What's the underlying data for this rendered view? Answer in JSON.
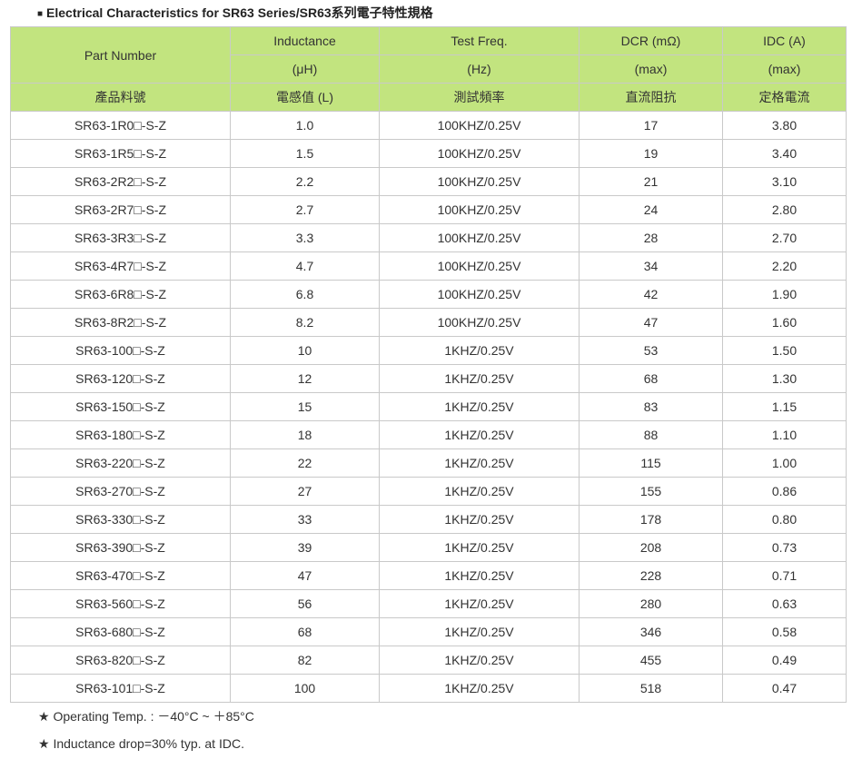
{
  "title": {
    "bullet": "■",
    "text": "Electrical Characteristics for SR63 Series/SR63系列電子特性規格"
  },
  "header": {
    "part_number": "Part Number",
    "inductance": "Inductance",
    "inductance_unit": "(μH)",
    "test_freq": "Test Freq.",
    "test_freq_unit": "(Hz)",
    "dcr": "DCR (mΩ)",
    "dcr_unit": "(max)",
    "idc": "IDC (A)",
    "idc_unit": "(max)",
    "part_number_cn": "產品料號",
    "inductance_cn": "電感值 (L)",
    "test_freq_cn": "測試頻率",
    "dcr_cn": "直流阻抗",
    "idc_cn": "定格電流"
  },
  "rows": [
    {
      "part": "SR63-1R0□-S-Z",
      "inductance": "1.0",
      "freq": "100KHZ/0.25V",
      "dcr": "17",
      "idc": "3.80"
    },
    {
      "part": "SR63-1R5□-S-Z",
      "inductance": "1.5",
      "freq": "100KHZ/0.25V",
      "dcr": "19",
      "idc": "3.40"
    },
    {
      "part": "SR63-2R2□-S-Z",
      "inductance": "2.2",
      "freq": "100KHZ/0.25V",
      "dcr": "21",
      "idc": "3.10"
    },
    {
      "part": "SR63-2R7□-S-Z",
      "inductance": "2.7",
      "freq": "100KHZ/0.25V",
      "dcr": "24",
      "idc": "2.80"
    },
    {
      "part": "SR63-3R3□-S-Z",
      "inductance": "3.3",
      "freq": "100KHZ/0.25V",
      "dcr": "28",
      "idc": "2.70"
    },
    {
      "part": "SR63-4R7□-S-Z",
      "inductance": "4.7",
      "freq": "100KHZ/0.25V",
      "dcr": "34",
      "idc": "2.20"
    },
    {
      "part": "SR63-6R8□-S-Z",
      "inductance": "6.8",
      "freq": "100KHZ/0.25V",
      "dcr": "42",
      "idc": "1.90"
    },
    {
      "part": "SR63-8R2□-S-Z",
      "inductance": "8.2",
      "freq": "100KHZ/0.25V",
      "dcr": "47",
      "idc": "1.60"
    },
    {
      "part": "SR63-100□-S-Z",
      "inductance": "10",
      "freq": "1KHZ/0.25V",
      "dcr": "53",
      "idc": "1.50"
    },
    {
      "part": "SR63-120□-S-Z",
      "inductance": "12",
      "freq": "1KHZ/0.25V",
      "dcr": "68",
      "idc": "1.30"
    },
    {
      "part": "SR63-150□-S-Z",
      "inductance": "15",
      "freq": "1KHZ/0.25V",
      "dcr": "83",
      "idc": "1.15"
    },
    {
      "part": "SR63-180□-S-Z",
      "inductance": "18",
      "freq": "1KHZ/0.25V",
      "dcr": "88",
      "idc": "1.10"
    },
    {
      "part": "SR63-220□-S-Z",
      "inductance": "22",
      "freq": "1KHZ/0.25V",
      "dcr": "115",
      "idc": "1.00"
    },
    {
      "part": "SR63-270□-S-Z",
      "inductance": "27",
      "freq": "1KHZ/0.25V",
      "dcr": "155",
      "idc": "0.86"
    },
    {
      "part": "SR63-330□-S-Z",
      "inductance": "33",
      "freq": "1KHZ/0.25V",
      "dcr": "178",
      "idc": "0.80"
    },
    {
      "part": "SR63-390□-S-Z",
      "inductance": "39",
      "freq": "1KHZ/0.25V",
      "dcr": "208",
      "idc": "0.73"
    },
    {
      "part": "SR63-470□-S-Z",
      "inductance": "47",
      "freq": "1KHZ/0.25V",
      "dcr": "228",
      "idc": "0.71"
    },
    {
      "part": "SR63-560□-S-Z",
      "inductance": "56",
      "freq": "1KHZ/0.25V",
      "dcr": "280",
      "idc": "0.63"
    },
    {
      "part": "SR63-680□-S-Z",
      "inductance": "68",
      "freq": "1KHZ/0.25V",
      "dcr": "346",
      "idc": "0.58"
    },
    {
      "part": "SR63-820□-S-Z",
      "inductance": "82",
      "freq": "1KHZ/0.25V",
      "dcr": "455",
      "idc": "0.49"
    },
    {
      "part": "SR63-101□-S-Z",
      "inductance": "100",
      "freq": "1KHZ/0.25V",
      "dcr": "518",
      "idc": "0.47"
    }
  ],
  "notes": [
    "★ Operating Temp. : －40°C ~ ＋85°C",
    "★ Inductance drop=30% typ. at IDC."
  ],
  "colors": {
    "header_bg": "#c2e47f",
    "border": "#c9c9c9",
    "text": "#333333"
  }
}
